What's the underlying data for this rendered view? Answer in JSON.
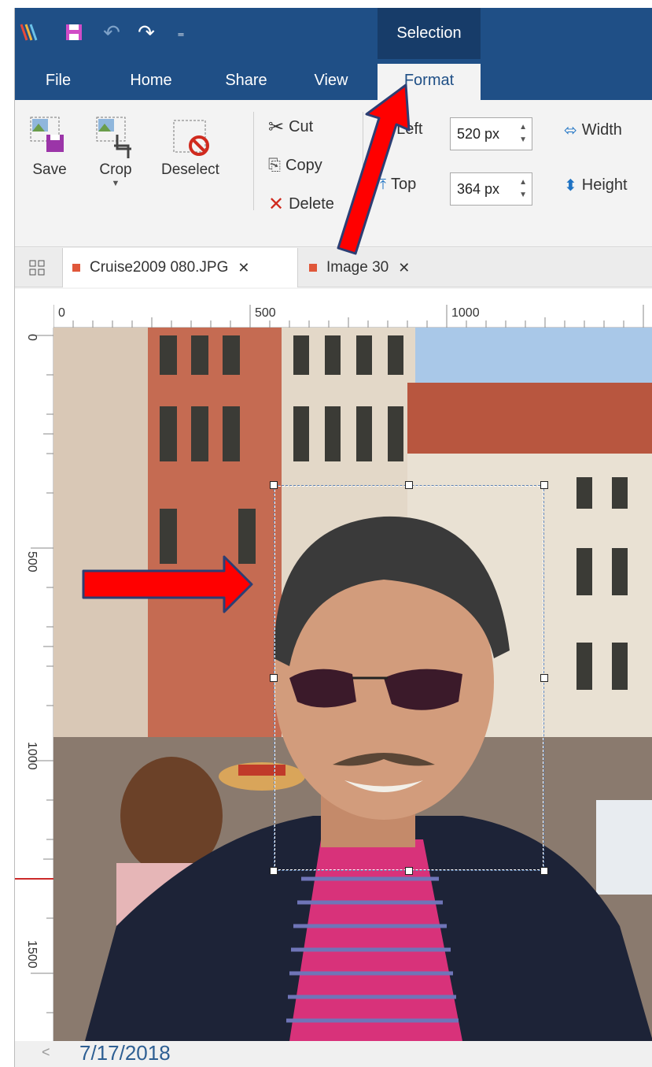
{
  "tabs_context": {
    "label": "Selection"
  },
  "menu": {
    "tabs": [
      "File",
      "Home",
      "Share",
      "View",
      "Format"
    ],
    "active_tab": "Format"
  },
  "ribbon": {
    "save_label": "Save",
    "crop_label": "Crop",
    "deselect_label": "Deselect",
    "cut_label": "Cut",
    "copy_label": "Copy",
    "delete_label": "Delete",
    "left_label": "Left",
    "left_value": "520 px",
    "top_label": "Top",
    "top_value": "364 px",
    "width_label": "Width",
    "height_label": "Height"
  },
  "documents": [
    {
      "name": "Cruise2009 080.JPG",
      "active": true
    },
    {
      "name": "Image 30",
      "active": false
    }
  ],
  "ruler": {
    "horizontal": [
      "0",
      "500",
      "1000"
    ],
    "vertical": [
      "0",
      "500",
      "1000",
      "1500"
    ]
  },
  "status": {
    "date": "7/17/2018"
  },
  "colors": {
    "titlebar": "#1f4f86",
    "context_tab": "#173c69",
    "annotation_arrow": "#e60000"
  },
  "icons": {
    "app": "app-logo-icon",
    "save": "save-icon",
    "undo": "undo-icon",
    "redo": "redo-icon",
    "customize": "customize-qat-icon"
  }
}
